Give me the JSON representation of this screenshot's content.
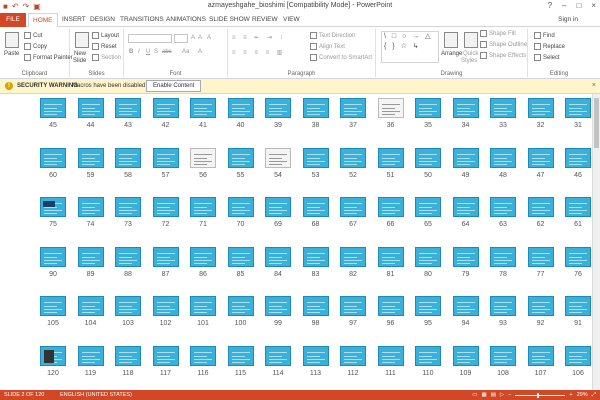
{
  "window": {
    "title": "azmayeshgahe_bioshimi [Compatibility Mode] - PowerPoint",
    "controls": [
      "?",
      "–",
      "□",
      "×"
    ]
  },
  "qat": [
    "save-icon",
    "undo-icon",
    "redo-icon",
    "slideshow-icon"
  ],
  "tabs": {
    "file": "FILE",
    "items": [
      "HOME",
      "INSERT",
      "DESIGN",
      "TRANSITIONS",
      "ANIMATIONS",
      "SLIDE SHOW",
      "REVIEW",
      "VIEW"
    ],
    "active": "HOME",
    "signin": "Sign in"
  },
  "ribbon": {
    "clipboard": {
      "label": "Clipboard",
      "paste": "Paste",
      "cut": "Cut",
      "copy": "Copy",
      "format_painter": "Format Painter"
    },
    "slides": {
      "label": "Slides",
      "new_slide": "New",
      "new_slide2": "Slide",
      "layout": "Layout",
      "reset": "Reset",
      "section": "Section"
    },
    "font": {
      "label": "Font",
      "bold": "B",
      "italic": "I",
      "underline": "U",
      "strike": "S",
      "abc": "abc",
      "aa": "Aa",
      "grow": "A",
      "shrink": "A"
    },
    "paragraph": {
      "label": "Paragraph",
      "text_direction": "Text Direction",
      "align_text": "Align Text",
      "convert": "Convert to SmartArt"
    },
    "drawing": {
      "label": "Drawing",
      "shapes": "\\ □ ○ → △ { } ☆ ↳",
      "arrange": "Arrange",
      "quick": "Quick",
      "styles": "Styles",
      "shape_fill": "Shape Fill",
      "shape_outline": "Shape Outline",
      "shape_effects": "Shape Effects"
    },
    "editing": {
      "label": "Editing",
      "find": "Find",
      "replace": "Replace",
      "select": "Select"
    }
  },
  "security": {
    "icon": "!",
    "title": "SECURITY WARNING",
    "message": "Macros have been disabled.",
    "button": "Enable Content",
    "close": "×"
  },
  "sorter": {
    "rows": [
      [
        "45",
        "44",
        "43",
        "42",
        "41",
        "40",
        "39",
        "38",
        "37",
        "36",
        "35",
        "34",
        "33",
        "32",
        "31"
      ],
      [
        "60",
        "59",
        "58",
        "57",
        "56",
        "55",
        "54",
        "53",
        "52",
        "51",
        "50",
        "49",
        "48",
        "47",
        "46"
      ],
      [
        "75",
        "74",
        "73",
        "72",
        "71",
        "70",
        "69",
        "68",
        "67",
        "66",
        "65",
        "64",
        "63",
        "62",
        "61"
      ],
      [
        "90",
        "89",
        "88",
        "87",
        "86",
        "85",
        "84",
        "83",
        "82",
        "81",
        "80",
        "79",
        "78",
        "77",
        "76"
      ],
      [
        "105",
        "104",
        "103",
        "102",
        "101",
        "100",
        "99",
        "98",
        "97",
        "96",
        "95",
        "94",
        "93",
        "92",
        "91"
      ],
      [
        "120",
        "119",
        "118",
        "117",
        "116",
        "115",
        "114",
        "113",
        "112",
        "111",
        "110",
        "109",
        "108",
        "107",
        "106"
      ]
    ],
    "white_slides": [
      "36",
      "56",
      "54"
    ],
    "photo_slides": [
      "120"
    ],
    "dark_slides": [
      "75"
    ]
  },
  "statusbar": {
    "slide": "SLIDE 2 OF 120",
    "language": "ENGLISH (UNITED STATES)",
    "zoom": "29%"
  },
  "colors": {
    "accent": "#d24726",
    "slide_blue": "#3bb1da",
    "warning_bg": "#fff5cc"
  }
}
